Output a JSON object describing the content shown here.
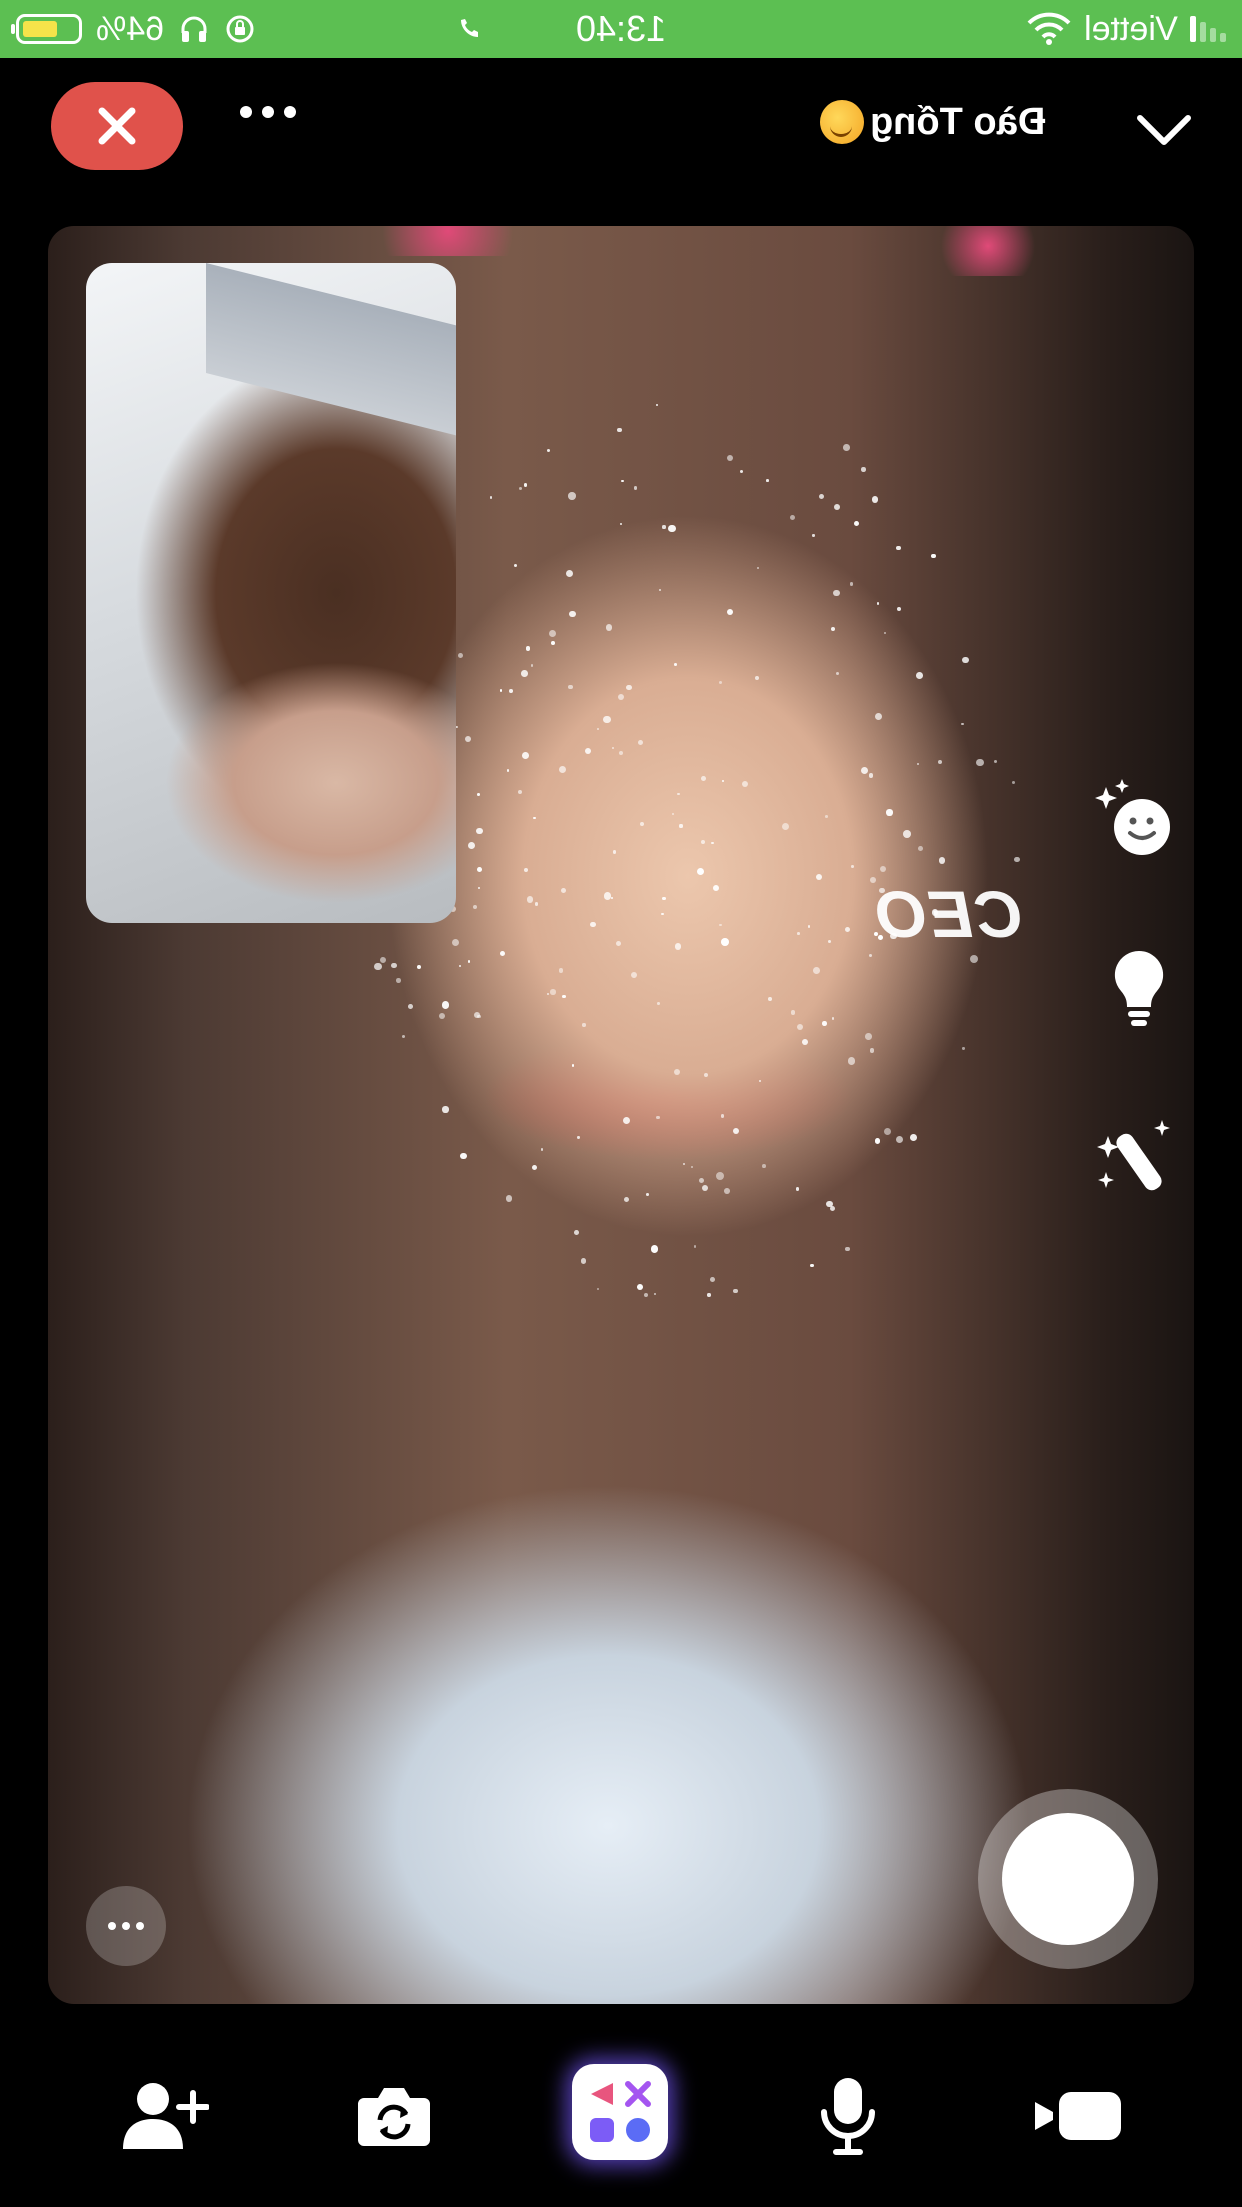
{
  "status_bar": {
    "battery": "64%",
    "time": "13:40",
    "carrier": "Viettel"
  },
  "header": {
    "contact_name": "Đào Tống",
    "contact_emoji": "🥰"
  },
  "effect_overlay_text": "CEO",
  "colors": {
    "status_bar": "#5cbf52",
    "end_call": "#e0524b",
    "background": "#000000",
    "effects_glow": "#785aff"
  },
  "icons": {
    "status_left": [
      "battery-icon",
      "headphones-icon",
      "rotation-lock-icon"
    ],
    "status_right": [
      "wifi-icon",
      "signal-icon",
      "phone-call-icon"
    ],
    "header": [
      "close-icon",
      "more-options-icon",
      "chevron-down-icon"
    ],
    "side_effects": [
      "face-effects-icon",
      "lightbulb-icon",
      "magic-wand-icon"
    ],
    "bottom_bar": [
      "add-person-icon",
      "flip-camera-icon",
      "effects-icon",
      "microphone-icon",
      "video-camera-icon"
    ]
  }
}
